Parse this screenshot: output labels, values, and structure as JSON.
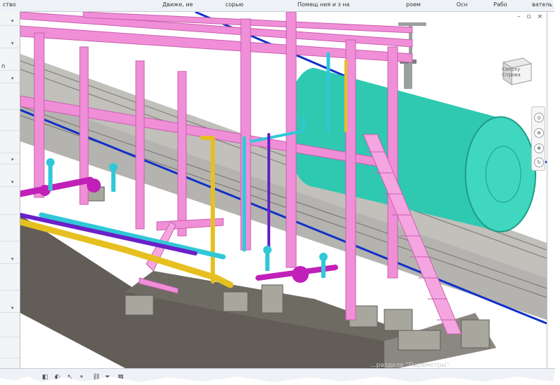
{
  "ribbon": {
    "tabs": [
      "ство",
      "Движе, ие",
      "сорью",
      "Помещ ния и з на",
      "роем",
      "Осн",
      "Рабо",
      "ватель"
    ]
  },
  "left_panel": {
    "rows": [
      "",
      "",
      "",
      "п",
      "",
      "",
      "",
      "",
      "",
      "",
      "",
      "",
      "",
      "",
      "",
      "",
      "",
      "",
      "",
      "",
      "",
      "",
      "",
      ""
    ]
  },
  "viewport": {
    "controls": [
      "–",
      "▫",
      "×"
    ],
    "viewcube_label": "Сверху Справа",
    "hint_text": "...разделе \"Параметры\".",
    "colors": {
      "pipe_rack": "#f08fd8",
      "pipe_rack_dark": "#c85fb0",
      "tank": "#2ec9b0",
      "tank_dark": "#1f9c88",
      "blue_line": "#1030c8",
      "pipe_yellow": "#e6c020",
      "pipe_purple": "#6a20c8",
      "pipe_cyan": "#30c8d8",
      "valve_magenta": "#c020b8",
      "concrete": "#9a9a90",
      "concrete_dark": "#6a6a62",
      "rail": "#4a4a44",
      "grating": "#5a5750"
    }
  },
  "status_bar": {
    "icons": [
      "select-icon",
      "hide-icon",
      "cursor-icon",
      "pin-icon",
      "link-icon",
      "filter-icon",
      "grid-icon"
    ]
  }
}
